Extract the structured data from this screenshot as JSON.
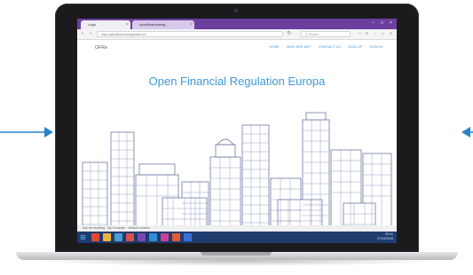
{
  "browser": {
    "tab1_label": "Logo",
    "tab2_label": "openfinancialreg...",
    "url": "www.openfinancialregulation.eu",
    "search_placeholder": "Q Search"
  },
  "site": {
    "logo": "OFRe",
    "nav": [
      {
        "label": "HOME"
      },
      {
        "label": "WHO ARE WE?"
      },
      {
        "label": "CONTACT US"
      },
      {
        "label": "SIGN UP"
      },
      {
        "label": "SIGN IN"
      }
    ],
    "hero_title": "Open Financial Regulation Europa"
  },
  "status": {
    "text": "Ask me anything   ·   My Computer   ·   Network Access"
  },
  "taskbar": {
    "tray_time": "09:41",
    "tray_date": "27/10/2016"
  },
  "colors": {
    "accent": "#3e9ad9",
    "arrow": "#2a83c8",
    "tabbar": "#6c3f9e",
    "taskbar": "#1f3c6e"
  }
}
